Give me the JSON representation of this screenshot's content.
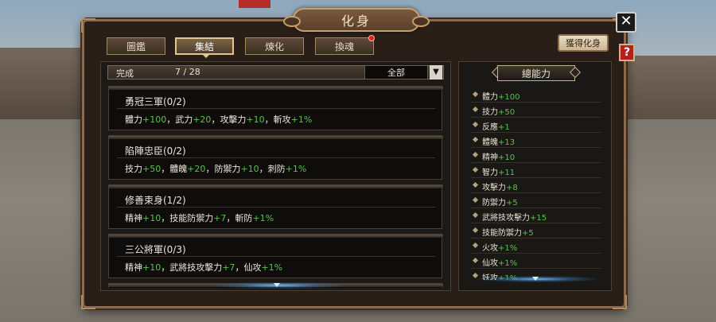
{
  "window": {
    "title": "化身"
  },
  "controls": {
    "close_icon": "✕",
    "help_icon": "?"
  },
  "tabs": [
    {
      "label": "圖鑑",
      "active": false
    },
    {
      "label": "集結",
      "active": true
    },
    {
      "label": "煉化",
      "active": false
    },
    {
      "label": "換魂",
      "active": false,
      "notification": true
    }
  ],
  "obtain_button": "獲得化身",
  "filter": {
    "label": "完成",
    "progress": "7 / 28",
    "selected": "全部",
    "arrow": "▼"
  },
  "sets": [
    {
      "name": "勇冠三軍(0/2)",
      "bonuses": [
        {
          "stat": "體力",
          "value": "+100"
        },
        {
          "stat": "武力",
          "value": "+20"
        },
        {
          "stat": "攻擊力",
          "value": "+10"
        },
        {
          "stat": "斬攻",
          "value": "+1%"
        }
      ]
    },
    {
      "name": "陷陣忠臣(0/2)",
      "bonuses": [
        {
          "stat": "技力",
          "value": "+50"
        },
        {
          "stat": "體魄",
          "value": "+20"
        },
        {
          "stat": "防禦力",
          "value": "+10"
        },
        {
          "stat": "刺防",
          "value": "+1%"
        }
      ]
    },
    {
      "name": "修善束身(1/2)",
      "bonuses": [
        {
          "stat": "精神",
          "value": "+10"
        },
        {
          "stat": "技能防禦力",
          "value": "+7"
        },
        {
          "stat": "斬防",
          "value": "+1%"
        }
      ]
    },
    {
      "name": "三公將軍(0/3)",
      "bonuses": [
        {
          "stat": "精神",
          "value": "+10"
        },
        {
          "stat": "武將技攻擊力",
          "value": "+7"
        },
        {
          "stat": "仙攻",
          "value": "+1%"
        }
      ]
    }
  ],
  "stats_panel": {
    "title": "總能力",
    "items": [
      {
        "stat": "體力",
        "value": "+100"
      },
      {
        "stat": "技力",
        "value": "+50"
      },
      {
        "stat": "反應",
        "value": "+1"
      },
      {
        "stat": "體魄",
        "value": "+13"
      },
      {
        "stat": "精神",
        "value": "+10"
      },
      {
        "stat": "智力",
        "value": "+11"
      },
      {
        "stat": "攻擊力",
        "value": "+8"
      },
      {
        "stat": "防禦力",
        "value": "+5"
      },
      {
        "stat": "武將技攻擊力",
        "value": "+15"
      },
      {
        "stat": "技能防禦力",
        "value": "+5"
      },
      {
        "stat": "火攻",
        "value": "+1%"
      },
      {
        "stat": "仙攻",
        "value": "+1%"
      },
      {
        "stat": "妖攻",
        "value": "+1%"
      }
    ]
  },
  "colors": {
    "bonus_value": "#56c34a",
    "frame": "#8a6a4a",
    "close_bg": "#1b1b1b",
    "help_bg": "#b3201d"
  }
}
